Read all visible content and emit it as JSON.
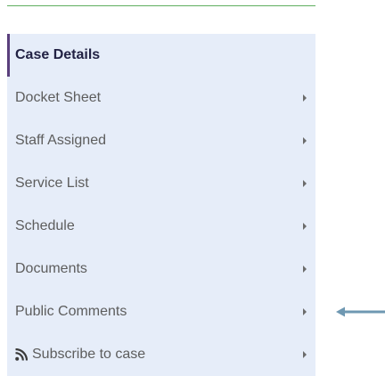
{
  "menu": {
    "items": [
      {
        "label": "Case Details",
        "active": true,
        "has_submenu": false
      },
      {
        "label": "Docket Sheet",
        "active": false,
        "has_submenu": true
      },
      {
        "label": "Staff Assigned",
        "active": false,
        "has_submenu": true
      },
      {
        "label": "Service List",
        "active": false,
        "has_submenu": true
      },
      {
        "label": "Schedule",
        "active": false,
        "has_submenu": true
      },
      {
        "label": "Documents",
        "active": false,
        "has_submenu": true
      },
      {
        "label": "Public Comments",
        "active": false,
        "has_submenu": true
      },
      {
        "label": "Subscribe to case",
        "active": false,
        "has_submenu": true,
        "icon": "rss-icon"
      }
    ]
  },
  "colors": {
    "menu_background": "#e6edf9",
    "active_border": "#5a3f7c",
    "top_rule": "#5fae5f",
    "arrow": "#6f98b2"
  },
  "annotation": {
    "icon": "left-arrow-icon",
    "points_to": "Public Comments"
  }
}
